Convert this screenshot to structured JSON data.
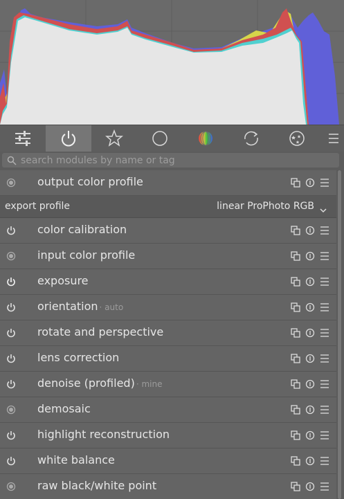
{
  "search": {
    "placeholder": "search modules by name or tag"
  },
  "tabs": [
    {
      "name": "quick-access-panel",
      "icon": "sliders-icon",
      "active": false
    },
    {
      "name": "active-modules",
      "icon": "power-icon",
      "active": true
    },
    {
      "name": "base-modules",
      "icon": "star-icon",
      "active": false
    },
    {
      "name": "tone-modules",
      "icon": "circle-icon",
      "active": false
    },
    {
      "name": "color-modules",
      "icon": "color-circle-icon",
      "active": false
    },
    {
      "name": "correct-modules",
      "icon": "correct-icon",
      "active": false
    },
    {
      "name": "effect-modules",
      "icon": "effects-icon",
      "active": false
    }
  ],
  "modules": [
    {
      "name": "output color profile",
      "label": "",
      "state": "default"
    },
    {
      "name": "color calibration",
      "label": "",
      "state": "on"
    },
    {
      "name": "input color profile",
      "label": "",
      "state": "default"
    },
    {
      "name": "exposure",
      "label": "",
      "state": "on-bright"
    },
    {
      "name": "orientation",
      "label": "auto",
      "state": "on"
    },
    {
      "name": "rotate and perspective",
      "label": "",
      "state": "on"
    },
    {
      "name": "lens correction",
      "label": "",
      "state": "on"
    },
    {
      "name": "denoise (profiled)",
      "label": "mine",
      "state": "on"
    },
    {
      "name": "demosaic",
      "label": "",
      "state": "default"
    },
    {
      "name": "highlight reconstruction",
      "label": "",
      "state": "on"
    },
    {
      "name": "white balance",
      "label": "",
      "state": "on"
    },
    {
      "name": "raw black/white point",
      "label": "",
      "state": "default"
    }
  ],
  "export_profile": {
    "label": "export profile",
    "value": "linear ProPhoto RGB"
  },
  "module_buttons": [
    "presets-icon",
    "reset-icon",
    "menu-icon"
  ]
}
